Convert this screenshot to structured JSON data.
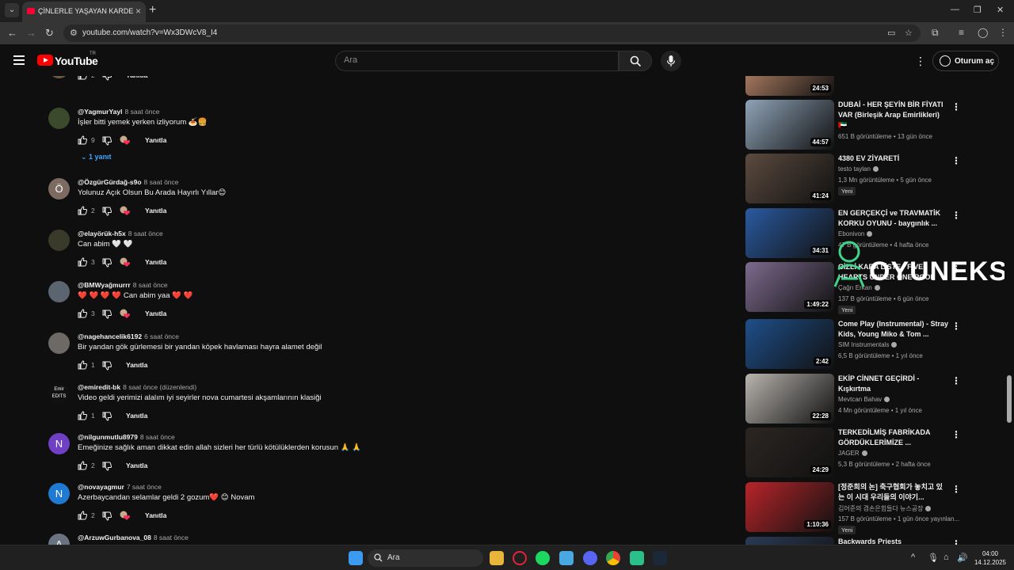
{
  "browser": {
    "tab_title": "ÇİNLERLE YAŞAYAN KARDEŞLER",
    "url": "youtube.com/watch?v=Wx3DWcV8_I4"
  },
  "header": {
    "logo_text": "YouTube",
    "country_code": "TR",
    "search_placeholder": "Ara",
    "signin_label": "Oturum aç"
  },
  "comments": [
    {
      "author": "",
      "time": "",
      "text": "",
      "likes": "2",
      "reply": "Yanıtla",
      "avatar_letter": "",
      "avatar_color": "#6b5a45",
      "has_heart": false
    },
    {
      "author": "@YagmurYayl",
      "time": "8 saat önce",
      "text": "İşler bitti yemek yerken izliyorum 🍝🍔",
      "likes": "9",
      "reply": "Yanıtla",
      "avatar_letter": "",
      "avatar_color": "#3b4a2c",
      "has_heart": true,
      "replies_label": "1 yanıt"
    },
    {
      "author": "@ÖzgürGürdağ-s9o",
      "time": "8 saat önce",
      "text": "Yolunuz Açık Olsun Bu Arada Hayırlı Yıllar😊",
      "likes": "2",
      "reply": "Yanıtla",
      "avatar_letter": "Ö",
      "avatar_color": "#7d6b62",
      "has_heart": true
    },
    {
      "author": "@elayörük-h5x",
      "time": "8 saat önce",
      "text": "Can abim 🤍 🤍",
      "likes": "3",
      "reply": "Yanıtla",
      "avatar_letter": "",
      "avatar_color": "#3a3a2a",
      "has_heart": true
    },
    {
      "author": "@BMWyağmurrr",
      "time": "8 saat önce",
      "text": "❤️ ❤️ ❤️ ❤️ Can abim yaa ❤️ ❤️",
      "likes": "3",
      "reply": "Yanıtla",
      "avatar_letter": "",
      "avatar_color": "#5a6570",
      "has_heart": true
    },
    {
      "author": "@nagehancelik6192",
      "time": "6 saat önce",
      "text": "Bir yandan gök gürlemesi bir yandan köpek havlaması hayra alamet değil",
      "likes": "1",
      "reply": "Yanıtla",
      "avatar_letter": "",
      "avatar_color": "#6d6a66",
      "has_heart": false
    },
    {
      "author": "@emiredit-bk",
      "time": "8 saat önce (düzenlendi)",
      "text": "Video geldi yerimizi alalım iyi  seyirler nova cumartesi akşamlarının klasiği",
      "likes": "1",
      "reply": "Yanıtla",
      "avatar_letter": "Emir EDITS",
      "avatar_color": "#111111",
      "has_heart": false
    },
    {
      "author": "@nilgunmutlu8979",
      "time": "8 saat önce",
      "text": "Emeğinize sağlık aman dikkat edin allah sizleri her türlü kötülüklerden korusun 🙏 🙏",
      "likes": "2",
      "reply": "Yanıtla",
      "avatar_letter": "N",
      "avatar_color": "#6f3fc4",
      "has_heart": false
    },
    {
      "author": "@novayagmur",
      "time": "7 saat önce",
      "text": "Azerbaycandan selamlar geldi 2 gozum❤️ 😊 Novam",
      "likes": "2",
      "reply": "Yanıtla",
      "avatar_letter": "N",
      "avatar_color": "#1f7ad1",
      "has_heart": true
    },
    {
      "author": "@ArzuwGurbanova_08",
      "time": "8 saat önce",
      "text": "",
      "likes": "",
      "reply": "",
      "avatar_letter": "A",
      "avatar_color": "#6a7480",
      "has_heart": false
    }
  ],
  "related": [
    {
      "title": "",
      "channel": "",
      "meta": "",
      "duration": "24:53",
      "thumb_color": "#a87a60",
      "is_new": false
    },
    {
      "title": "DUBAİ - HER ŞEYİN BİR FİYATI VAR (Birleşik Arap Emirlikleri) 🇦🇪",
      "channel": "",
      "meta": "651 B görüntüleme • 13 gün önce",
      "duration": "44:57",
      "thumb_color": "#8fa3b8",
      "is_new": false
    },
    {
      "title": "4380 EV ZİYARETİ",
      "channel": "testo taylan",
      "meta": "1,3 Mn görüntüleme • 5 gün önce",
      "duration": "41:24",
      "thumb_color": "#5b4a3e",
      "is_new": true
    },
    {
      "title": "EN GERÇEKÇİ ve TRAVMATİK KORKU OYUNU - baygınlık ...",
      "channel": "Ebonivon",
      "meta": "47 B görüntüleme • 4 hafta önce",
      "duration": "34:31",
      "thumb_color": "#2a5aa0",
      "is_new": false
    },
    {
      "title": "GİZLİ KARA LİSTE - FIVE HEARTS UNDER ONE ROOF",
      "channel": "Çağrı Erkan",
      "meta": "137 B görüntüleme • 6 gün önce",
      "duration": "1:49:22",
      "thumb_color": "#7d6a8e",
      "is_new": true
    },
    {
      "title": "Come Play (Instrumental) - Stray Kids, Young Miko & Tom ...",
      "channel": "SIM Instrumentals",
      "meta": "6,5 B görüntüleme • 1 yıl önce",
      "duration": "2:42",
      "thumb_color": "#1e4f8a",
      "is_new": false
    },
    {
      "title": "EKİP CİNNET GEÇİRDİ - Kışkırtma",
      "channel": "Mevtcan Bahav",
      "meta": "4 Mn görüntüleme • 1 yıl önce",
      "duration": "22:28",
      "thumb_color": "#b8b4ae",
      "is_new": false
    },
    {
      "title": "TERKEDİLMİŞ FABRİKADA GÖRDÜKLERİMİZE ...",
      "channel": "JAGER",
      "meta": "5,3 B görüntüleme • 2 hafta önce",
      "duration": "24:29",
      "thumb_color": "#2c2622",
      "is_new": false
    },
    {
      "title": "[정준희의 논] 축구협회가 놓치고 있는 이 시대 우리들의 이야기...",
      "channel": "김어준의 겸손은힘들다 뉴스공장",
      "meta": "157 B görüntüleme • 1 gün önce yayınlan...",
      "duration": "1:10:36",
      "thumb_color": "#b8252a",
      "is_new": true
    },
    {
      "title": "Backwards Priests",
      "channel": "",
      "meta": "",
      "duration": "",
      "thumb_color": "#2a3a55",
      "is_new": false
    }
  ],
  "labels": {
    "new_badge": "Yeni"
  },
  "watermark": {
    "text": "OYUNEKS"
  },
  "taskbar": {
    "search_label": "Ara",
    "time": "04:00",
    "date": "14.12.2025"
  }
}
